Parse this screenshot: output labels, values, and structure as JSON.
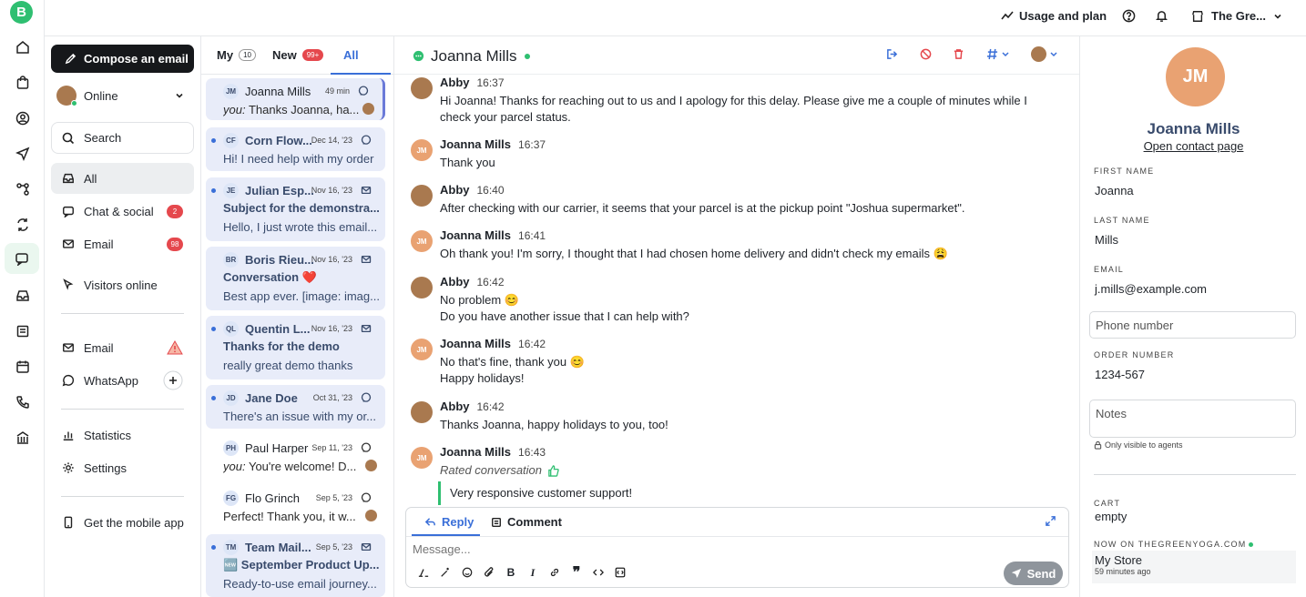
{
  "rail": {
    "logo": "B"
  },
  "topbar": {
    "usage_label": "Usage and plan",
    "store_label": "The Gre..."
  },
  "sidebar": {
    "compose_label": "Compose an email",
    "status_label": "Online",
    "search_label": "Search",
    "nav_all": "All",
    "nav_chat": "Chat & social",
    "nav_chat_badge": "2",
    "nav_email": "Email",
    "nav_email_badge": "98",
    "nav_visitors": "Visitors online",
    "channel_email": "Email",
    "channel_whatsapp": "WhatsApp",
    "statistics": "Statistics",
    "settings": "Settings",
    "mobile_app": "Get the mobile app"
  },
  "inbox": {
    "tab_my": "My",
    "tab_my_count": "10",
    "tab_new": "New",
    "tab_new_count": "99+",
    "tab_all": "All",
    "conversations": [
      {
        "initials": "JM",
        "name": "Joanna Mills",
        "date": "49 min",
        "you": "you:",
        "preview": "Thanks Joanna, ha..."
      },
      {
        "initials": "CF",
        "name": "Corn Flow...",
        "date": "Dec 14, '23",
        "preview": "Hi! I need help with my order"
      },
      {
        "initials": "JE",
        "name": "Julian Esp...",
        "date": "Nov 16, '23",
        "subject": "Subject for the demonstra...",
        "preview": "Hello, I just wrote this email..."
      },
      {
        "initials": "BR",
        "name": "Boris Rieu...",
        "date": "Nov 16, '23",
        "subject": "Conversation ❤️",
        "preview": "Best app ever. [image: imag..."
      },
      {
        "initials": "QL",
        "name": "Quentin L...",
        "date": "Nov 16, '23",
        "subject": "Thanks for the demo",
        "preview": "really great demo thanks"
      },
      {
        "initials": "JD",
        "name": "Jane Doe",
        "date": "Oct 31, '23",
        "preview": "There's an issue with my or..."
      },
      {
        "initials": "PH",
        "name": "Paul Harper",
        "date": "Sep 11, '23",
        "you": "you:",
        "preview": "You're welcome! D..."
      },
      {
        "initials": "FG",
        "name": "Flo Grinch",
        "date": "Sep 5, '23",
        "preview": "Perfect! Thank you, it w..."
      },
      {
        "initials": "TM",
        "name": "Team Mail...",
        "date": "Sep 5, '23",
        "subject": "🆕 September Product Up...",
        "preview": "Ready-to-use email journey..."
      }
    ]
  },
  "chat": {
    "contact_name": "Joanna Mills",
    "messages": [
      {
        "who": "Abby",
        "time": "16:37",
        "text": "Hi Joanna! Thanks for reaching out to us and I apology for this delay. Please give me a couple of minutes while I check your parcel status."
      },
      {
        "who": "Joanna Mills",
        "initials": "JM",
        "time": "16:37",
        "text": "Thank you"
      },
      {
        "who": "Abby",
        "time": "16:40",
        "text": "After checking with our carrier, it seems that your parcel is at the pickup point \"Joshua supermarket\"."
      },
      {
        "who": "Joanna Mills",
        "initials": "JM",
        "time": "16:41",
        "text": "Oh thank you! I'm sorry, I thought that I had chosen home delivery and didn't check my emails 😩"
      },
      {
        "who": "Abby",
        "time": "16:42",
        "text": "No problem 😊",
        "text2": "Do you have another issue that I can help with?"
      },
      {
        "who": "Joanna Mills",
        "initials": "JM",
        "time": "16:42",
        "text": "No that's fine, thank you 😊",
        "text2": "Happy holidays!"
      },
      {
        "who": "Abby",
        "time": "16:42",
        "text": "Thanks Joanna, happy holidays to you, too!"
      },
      {
        "who": "Joanna Mills",
        "initials": "JM",
        "time": "16:43",
        "text": "Rated conversation"
      }
    ],
    "rating_quote": "Very responsive customer support!",
    "reply_tab": "Reply",
    "comment_tab": "Comment",
    "message_placeholder": "Message...",
    "send_label": "Send"
  },
  "contact": {
    "initials": "JM",
    "name": "Joanna Mills",
    "open_link": "Open contact page",
    "first_name_label": "FIRST NAME",
    "first_name": "Joanna",
    "last_name_label": "LAST NAME",
    "last_name": "Mills",
    "email_label": "EMAIL",
    "email": "j.mills@example.com",
    "phone_placeholder": "Phone number",
    "order_label": "ORDER NUMBER",
    "order": "1234-567",
    "notes_placeholder": "Notes",
    "notes_hint": "Only visible to agents",
    "cart_label": "CART",
    "cart": "empty",
    "now_on_label": "NOW ON THEGREENYOGA.COM",
    "page": "My Store",
    "page_time": "59 minutes ago"
  },
  "colors": {
    "accent": "#3a6fd8",
    "brand": "#2fbf71",
    "badge": "#e5484d"
  }
}
